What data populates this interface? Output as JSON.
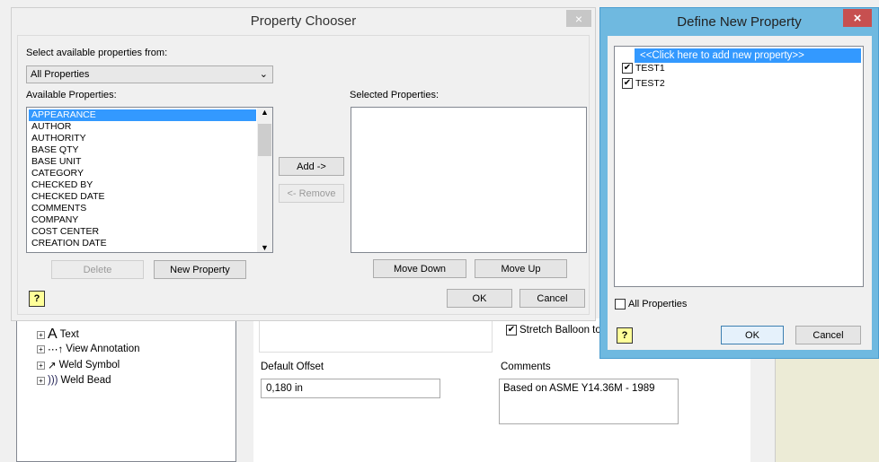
{
  "background": {
    "tree": [
      "Text",
      "View Annotation",
      "Weld Symbol",
      "Weld Bead"
    ],
    "stretch_label": "Stretch Balloon to",
    "default_offset_label": "Default Offset",
    "default_offset_value": "0,180 in",
    "comments_label": "Comments",
    "comments_value": "Based on ASME Y14.36M - 1989"
  },
  "chooser": {
    "title": "Property Chooser",
    "close": "×",
    "source_label": "Select available properties from:",
    "source_value": "All Properties",
    "available_label": "Available Properties:",
    "selected_label": "Selected Properties:",
    "available": [
      "APPEARANCE",
      "AUTHOR",
      "AUTHORITY",
      "BASE QTY",
      "BASE UNIT",
      "CATEGORY",
      "CHECKED BY",
      "CHECKED DATE",
      "COMMENTS",
      "COMPANY",
      "COST CENTER",
      "CREATION DATE"
    ],
    "add": "Add ->",
    "remove": "<- Remove",
    "delete": "Delete",
    "new_property": "New Property",
    "move_down": "Move Down",
    "move_up": "Move Up",
    "ok": "OK",
    "cancel": "Cancel",
    "help": "?"
  },
  "define": {
    "title": "Define New Property",
    "close": "×",
    "add_row": "<<Click here to add new property>>",
    "items": [
      {
        "label": "TEST1",
        "checked": true
      },
      {
        "label": "TEST2",
        "checked": true
      }
    ],
    "all_properties": "All Properties",
    "ok": "OK",
    "cancel": "Cancel",
    "help": "?"
  },
  "colors": {
    "accent": "#3399ff",
    "define_border": "#6fb9e0",
    "close_red": "#c75050"
  }
}
